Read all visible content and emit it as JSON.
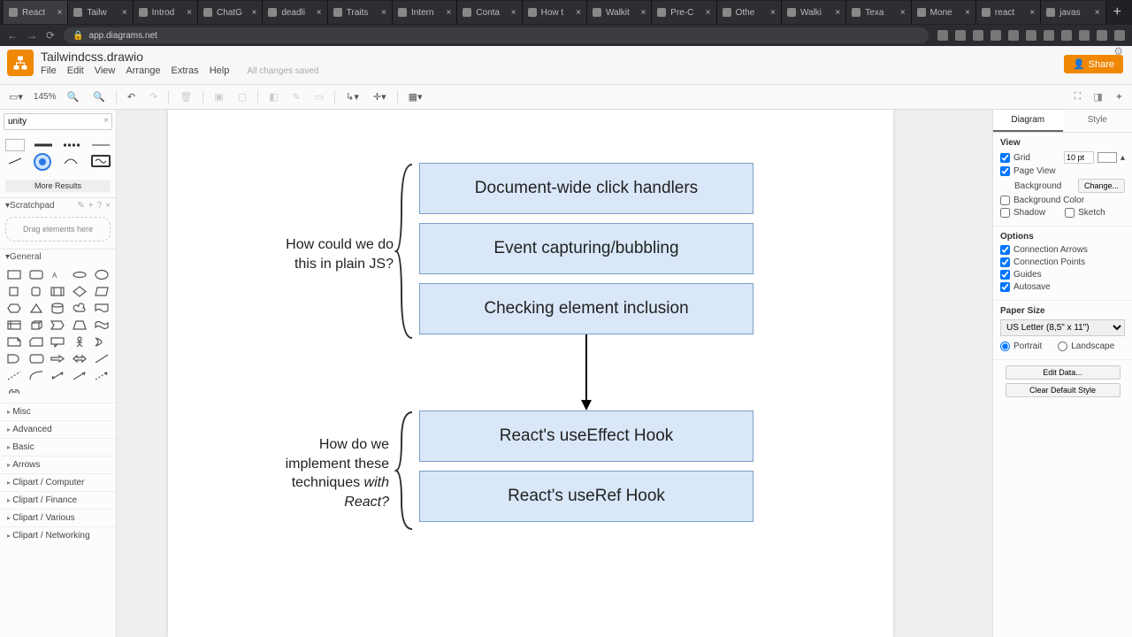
{
  "browser": {
    "url": "app.diagrams.net",
    "tabs": [
      "React",
      "Tailw",
      "Introd",
      "ChatG",
      "deadli",
      "Traits",
      "Intern",
      "Conta",
      "How t",
      "Walkit",
      "Pre-C",
      "Othe",
      "Walki",
      "Texa",
      "Mone",
      "react",
      "javas"
    ],
    "active_tab": 0
  },
  "app": {
    "title": "Tailwindcss.drawio",
    "menus": [
      "File",
      "Edit",
      "View",
      "Arrange",
      "Extras",
      "Help"
    ],
    "saved_msg": "All changes saved",
    "share": "Share",
    "zoom": "145%"
  },
  "left": {
    "search_placeholder": "unity",
    "more_results": "More Results",
    "scratchpad": "Scratchpad",
    "drop_hint": "Drag elements here",
    "general": "General",
    "cats": [
      "Misc",
      "Advanced",
      "Basic",
      "Arrows",
      "Clipart / Computer",
      "Clipart / Finance",
      "Clipart / Various",
      "Clipart / Networking"
    ]
  },
  "canvas": {
    "q1": "How could we do\nthis in plain JS?",
    "q2": "How do we\nimplement these\ntechniques with\nReact?",
    "q2_em": "with\nReact?",
    "n1": "Document-wide click handlers",
    "n2": "Event capturing/bubbling",
    "n3": "Checking element inclusion",
    "n4": "React's useEffect Hook",
    "n5": "React's useRef Hook"
  },
  "right": {
    "tabs": [
      "Diagram",
      "Style"
    ],
    "view": "View",
    "grid": "Grid",
    "grid_val": "10 pt",
    "pageview": "Page View",
    "background": "Background",
    "change": "Change...",
    "bgcolor": "Background Color",
    "shadow": "Shadow",
    "sketch": "Sketch",
    "options": "Options",
    "conn_arrows": "Connection Arrows",
    "conn_points": "Connection Points",
    "guides": "Guides",
    "autosave": "Autosave",
    "papersize": "Paper Size",
    "paper_sel": "US Letter (8,5\" x 11\")",
    "portrait": "Portrait",
    "landscape": "Landscape",
    "edit_data": "Edit Data...",
    "clear_style": "Clear Default Style"
  }
}
